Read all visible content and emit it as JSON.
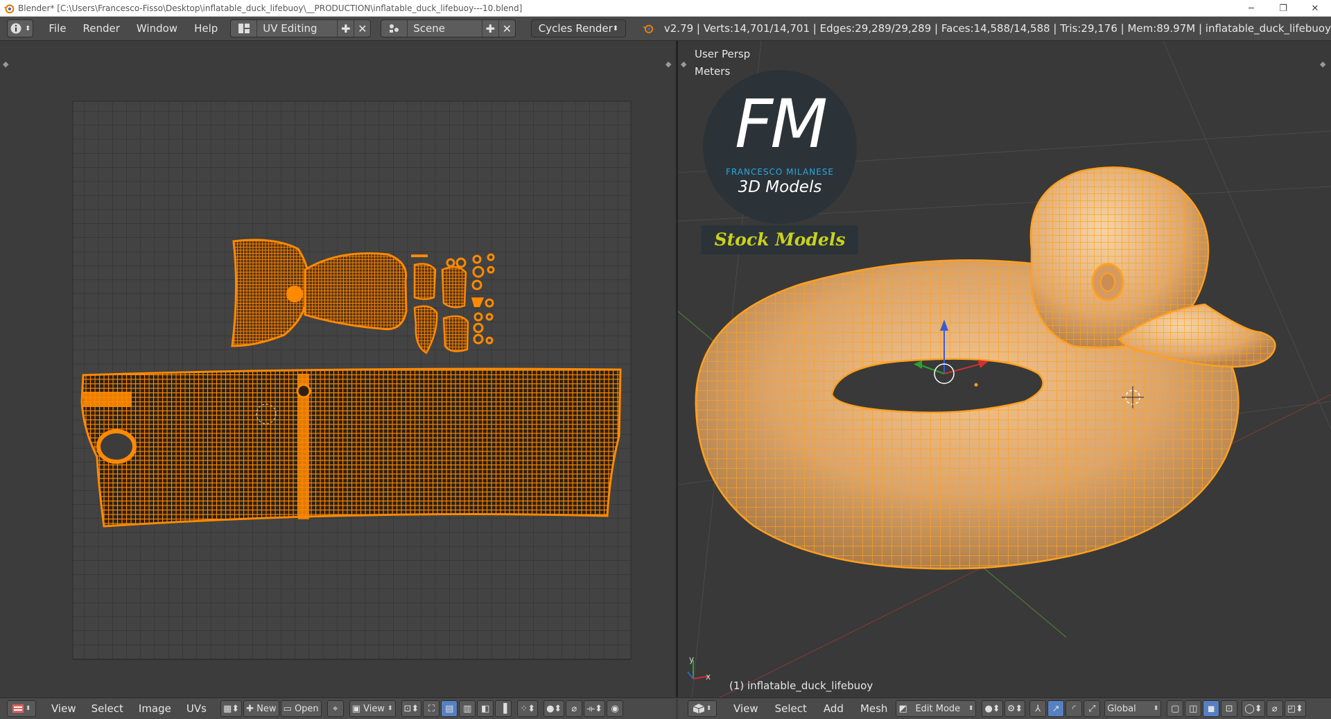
{
  "window": {
    "title": "Blender* [C:\\Users\\Francesco-Fisso\\Desktop\\inflatable_duck_lifebuoy\\__PRODUCTION\\inflatable_duck_lifebuoy---10.blend]",
    "minimize": "─",
    "maximize": "❐",
    "close": "✕"
  },
  "info_header": {
    "editor_icon": "info-icon",
    "menus": [
      "File",
      "Render",
      "Window",
      "Help"
    ],
    "screen_layout": "UV Editing",
    "scene": "Scene",
    "render_engine": "Cycles Render",
    "stats": "v2.79 | Verts:14,701/14,701 | Edges:29,289/29,289 | Faces:14,588/14,588 | Tris:29,176 | Mem:89.97M | inflatable_duck_lifebuoy"
  },
  "uv_header": {
    "menus": [
      "View",
      "Select",
      "Image",
      "UVs"
    ],
    "new_label": "New",
    "open_label": "Open",
    "view_label": "View"
  },
  "viewport": {
    "view_name": "User Persp",
    "units": "Meters",
    "object_label": "(1) inflatable_duck_lifebuoy",
    "axis_y": "y",
    "axis_x": "x"
  },
  "watermark": {
    "monogram": "FM",
    "author": "FRANCESCO MILANESE",
    "tagline": "3D Models",
    "badge": "Stock Models"
  },
  "view3d_header": {
    "menus": [
      "View",
      "Select",
      "Add",
      "Mesh"
    ],
    "mode": "Edit Mode",
    "orientation": "Global"
  },
  "colors": {
    "uv_orange": "#ff8a00",
    "wire_orange": "#ffa020",
    "duck_base": "#d9a46a",
    "accent_blue": "#29a8e0",
    "badge_yellow": "#c9d21c"
  }
}
